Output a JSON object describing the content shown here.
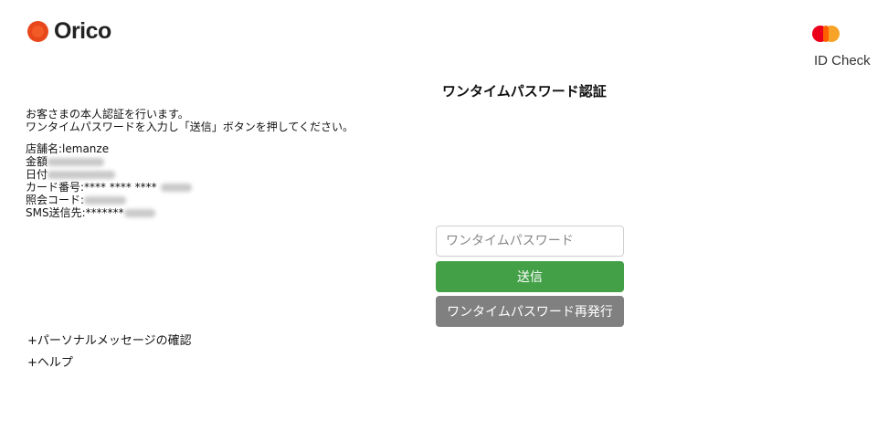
{
  "brand": {
    "logo_text": "Orico",
    "idcheck_label": "ID Check"
  },
  "page": {
    "title": "ワンタイムパスワード認証"
  },
  "intro": {
    "line1": "お客さまの本人認証を行います。",
    "line2": "ワンタイムパスワードを入力し「送信」ボタンを押してください。"
  },
  "details": {
    "store_label": "店舗名:",
    "store_value": "lemanze",
    "amount_label": "金額",
    "date_label": "日付",
    "card_label": "カード番号:",
    "card_value": "**** **** ****",
    "ref_label": "照会コード:",
    "sms_label": "SMS送信先:",
    "sms_value": "*******"
  },
  "form": {
    "otp_placeholder": "ワンタイムパスワード",
    "send_label": "送信",
    "resend_label": "ワンタイムパスワード再発行"
  },
  "links": {
    "personal_message": "+パーソナルメッセージの確認",
    "help": "+ヘルプ"
  },
  "colors": {
    "send": "#43a047",
    "resend": "#808080",
    "logo": "#e8471c"
  }
}
